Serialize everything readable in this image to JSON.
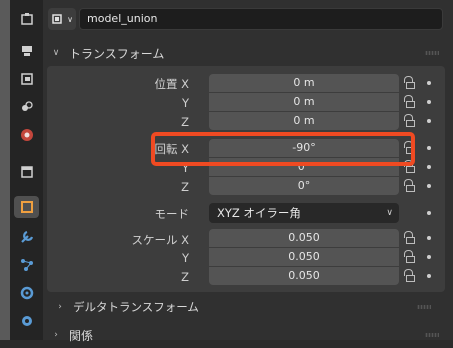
{
  "object_name": "model_union",
  "object_type_icon": "mesh-object-icon",
  "transform": {
    "title": "トランスフォーム",
    "location": {
      "label": "位置",
      "x_axis": "X",
      "y_axis": "Y",
      "z_axis": "Z",
      "x": "0 m",
      "y": "0 m",
      "z": "0 m"
    },
    "rotation": {
      "label": "回転",
      "x_axis": "X",
      "y_axis": "Y",
      "z_axis": "Z",
      "x": "-90°",
      "y": "0°",
      "z": "0°"
    },
    "mode": {
      "label": "モード",
      "value": "XYZ オイラー角"
    },
    "scale": {
      "label": "スケール",
      "x_axis": "X",
      "y_axis": "Y",
      "z_axis": "Z",
      "x": "0.050",
      "y": "0.050",
      "z": "0.050"
    }
  },
  "delta_transform": {
    "title": "デルタトランスフォーム"
  },
  "relations": {
    "title": "関係"
  },
  "sidebar_tabs": [
    "tool-icon",
    "render-icon",
    "output-icon",
    "view-layer-icon",
    "scene-icon",
    "world-icon",
    "collection-icon",
    "object-icon",
    "modifier-icon",
    "particles-icon",
    "physics-icon",
    "constraints-icon",
    "data-icon"
  ],
  "highlight_color": "#f04a22"
}
